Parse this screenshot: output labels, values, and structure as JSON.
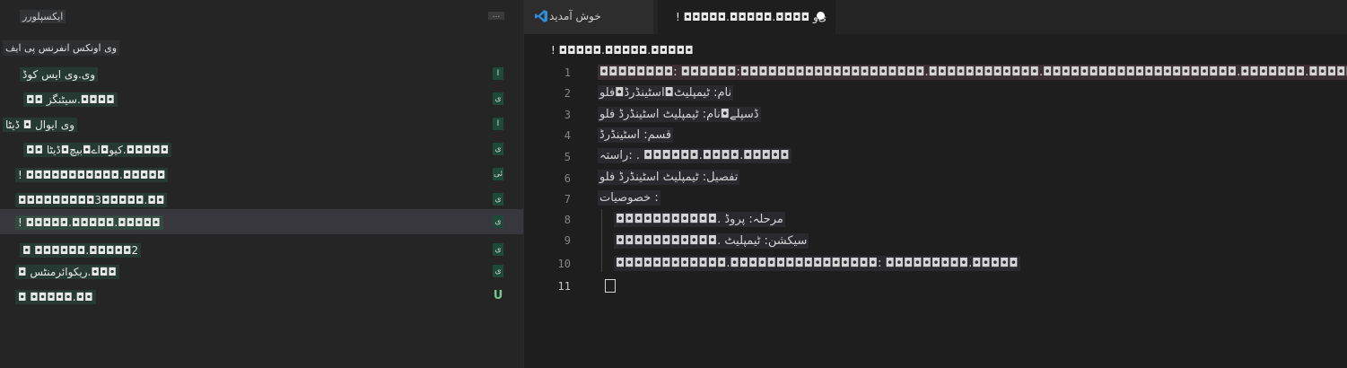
{
  "explorer": {
    "title": "ایکسپلورر",
    "more": "...",
    "project": "وی اونکس انفرنس پی ایف",
    "items": [
      {
        "label": "وی.وی ایس کوڈ",
        "badge": "I"
      },
      {
        "label": "◘◘ سیٹنگز.◘◘◘◘",
        "badge": "ی"
      },
      {
        "label": "وی ایوال ◘ ڈیٹا",
        "badge": "I"
      },
      {
        "label": "◘◘ کیو◘اے◘بیچ◘ڈیٹا.◘◘◘◘◘",
        "badge": "ی"
      },
      {
        "label": "! ◘◘◘◘◘◘◘◘◘◘◘.◘◘◘◘◘",
        "badge": "ئی"
      },
      {
        "label": "◘◘◘◘◘◘◘◘◘3◘◘◘◘◘.◘◘",
        "badge": "ی"
      },
      {
        "label": "! ◘◘◘◘◘.◘◘◘◘◘.◘◘◘◘◘",
        "badge": "ی"
      },
      {
        "label": "◘ ◘◘◘◘◘◘.◘◘◘◘◘2",
        "badge": "ی"
      },
      {
        "label": "◘ ریکوائرمنٹس.◘◘◘",
        "badge": "ی"
      },
      {
        "label": "◘ ◘◘◘◘◘.◘◘",
        "badge": "U"
      }
    ]
  },
  "tabs": [
    {
      "label": "خوش آمدید"
    },
    {
      "label": "! ◘◘◘◘◘.◘◘◘◘◘.◘◘◘◘ ی‌و"
    }
  ],
  "breadcrumb": "! ◘◘◘◘◘.◘◘◘◘◘.◘◘◘◘◘",
  "lines": [
    {
      "n": "1",
      "text": "◘◘◘◘◘◘◘◘: ◘◘◘◘◘◘:◘◘◘◘◘◘◘◘◘◘◘◘◘◘◘◘◘◘◘◘.◘◘◘◘◘◘◘◘◘◘◘◘.◘◘◘◘◘◘◘◘◘◘◘◘◘◘◘◘◘◘◘◘◘.◘◘◘◘◘◘◘.◘◘◘◘◘"
    },
    {
      "n": "2",
      "text": "نام: ٹیمپلیٹ◘اسٹینڈرڈ◘فلو"
    },
    {
      "n": "3",
      "text": "ڈسپلے◘نام: ٹیمپلیٹ اسٹینڈرڈ فلو"
    },
    {
      "n": "4",
      "text": "قسم: اسٹینڈرڈ"
    },
    {
      "n": "5",
      "text": "راستہ: . ◘◘◘◘◘◘.◘◘◘◘.◘◘◘◘◘"
    },
    {
      "n": "6",
      "text": "تفصیل: ٹیمپلیٹ اسٹینڈرڈ فلو"
    },
    {
      "n": "7",
      "text": "خصوصیات :"
    },
    {
      "n": "8",
      "text": "◘◘◘◘◘◘◘◘◘◘◘. مرحلہ: پروڈ"
    },
    {
      "n": "9",
      "text": "◘◘◘◘◘◘◘◘◘◘◘. سیکشن: ٹیمپلیٹ"
    },
    {
      "n": "10",
      "text": "◘◘◘◘◘◘◘◘◘◘◘◘.◘◘◘◘◘◘◘◘◘◘◘◘◘◘◘◘: ◘◘◘◘◘◘◘◘◘.◘◘◘◘◘"
    },
    {
      "n": "11",
      "text": ""
    }
  ],
  "colors": {
    "sidebar_bg": "#252526",
    "editor_bg": "#1e1e1e",
    "selected_row": "#37373d",
    "untracked": "#73c991",
    "vscode_blue": "#2f8ed6"
  }
}
